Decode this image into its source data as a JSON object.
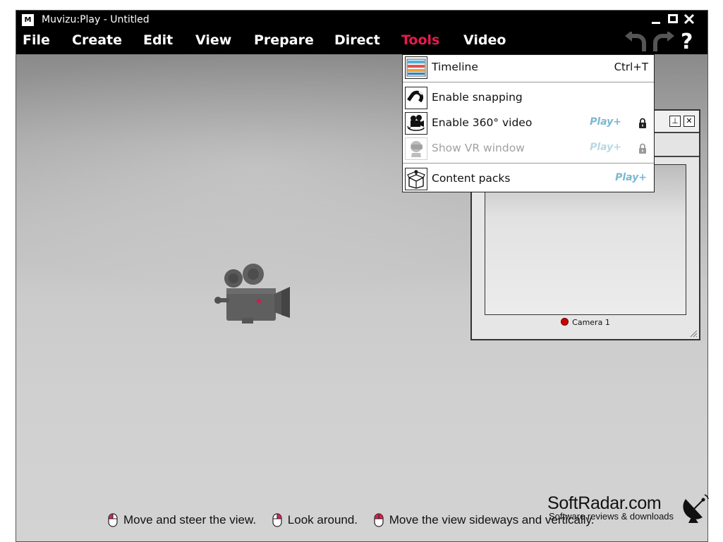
{
  "window": {
    "title": "Muvizu:Play - Untitled",
    "app_icon_text": "M",
    "controls": {
      "minimize": "—",
      "maximize": "☐",
      "close": "✕"
    }
  },
  "menubar": {
    "items": [
      "File",
      "Create",
      "Edit",
      "View",
      "Prepare",
      "Direct",
      "Tools",
      "Video"
    ],
    "active": "Tools",
    "help_label": "?"
  },
  "tools_menu": {
    "items": [
      {
        "label": "Timeline",
        "shortcut": "Ctrl+T",
        "icon": "timeline-icon",
        "enabled": true
      },
      {
        "label": "Enable snapping",
        "icon": "magnet-icon",
        "enabled": true
      },
      {
        "label": "Enable 360° video",
        "badge": "Play+",
        "locked": true,
        "icon": "video-camera-360-icon",
        "enabled": true
      },
      {
        "label": "Show VR window",
        "badge": "Play+",
        "locked": true,
        "icon": "vr-headset-icon",
        "enabled": false
      },
      {
        "label": "Content packs",
        "badge": "Play+",
        "icon": "content-box-icon",
        "enabled": true
      }
    ]
  },
  "preview_panel": {
    "camera_label": "Camera 1",
    "buttons": {
      "pin": "⊥",
      "close": "✕"
    }
  },
  "hints": [
    "Move and steer the view.",
    "Look around.",
    "Move the view sideways and vertically."
  ],
  "watermark": {
    "main": "SoftRadar.com",
    "sub": "Software reviews & downloads"
  },
  "colors": {
    "accent": "#e8194f",
    "badge": "#7ab8d0",
    "titlebar": "#000000"
  }
}
